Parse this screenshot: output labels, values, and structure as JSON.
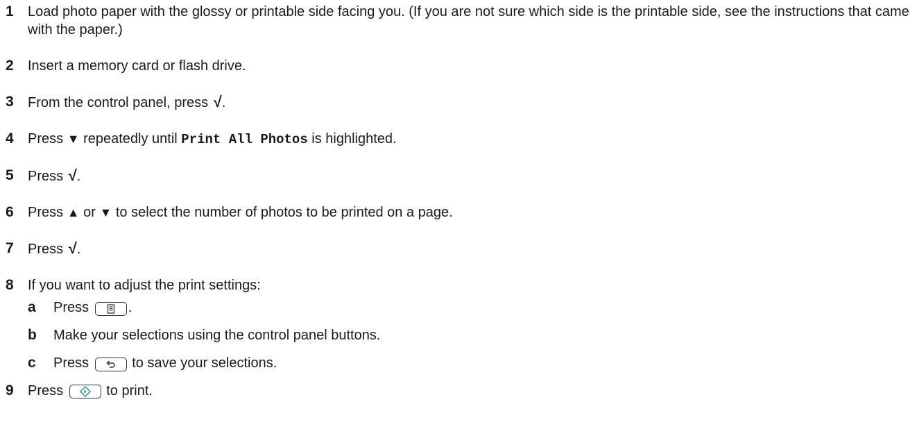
{
  "steps": [
    {
      "num": "1",
      "text": "Load photo paper with the glossy or printable side facing you. (If you are not sure which side is the printable side, see the instructions that came with the paper.)"
    },
    {
      "num": "2",
      "text": "Insert a memory card or flash drive."
    },
    {
      "num": "3",
      "pre": "From the control panel, press",
      "post": "."
    },
    {
      "num": "4",
      "pre": "Press",
      "mid": "repeatedly until",
      "code": "Print All Photos",
      "post": "is highlighted."
    },
    {
      "num": "5",
      "pre": "Press",
      "post": "."
    },
    {
      "num": "6",
      "pre": "Press",
      "or": "or",
      "post": "to select the number of photos to be printed on a page."
    },
    {
      "num": "7",
      "pre": "Press",
      "post": "."
    },
    {
      "num": "8",
      "text": "If you want to adjust the print settings:",
      "substeps": [
        {
          "label": "a",
          "pre": "Press",
          "post": "."
        },
        {
          "label": "b",
          "text": "Make your selections using the control panel buttons."
        },
        {
          "label": "c",
          "pre": "Press",
          "post": "to save your selections."
        }
      ]
    },
    {
      "num": "9",
      "pre": "Press",
      "post": "to print."
    }
  ],
  "icons": {
    "check": "√",
    "down": "▼",
    "up": "▲",
    "menu_button": "menu-icon",
    "back_button": "back-icon",
    "start_button": "start-icon",
    "start_color": "#2a9a8a"
  }
}
